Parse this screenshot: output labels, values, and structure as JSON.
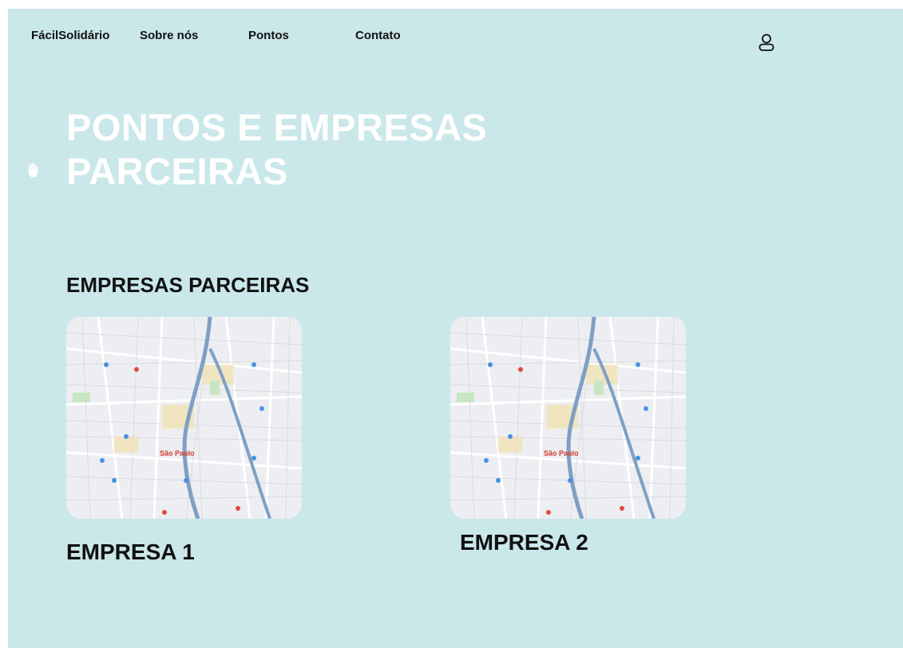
{
  "nav": {
    "brand": "FácilSolidário",
    "items": [
      {
        "label": "Sobre nós"
      },
      {
        "label": "Pontos"
      },
      {
        "label": "Contato"
      }
    ],
    "user_icon": "user-icon"
  },
  "hero": {
    "title": "PONTOS E EMPRESAS\nPARCEIRAS",
    "icon": "hand-icon"
  },
  "partners": {
    "section_title": "EMPRESAS PARCEIRAS",
    "cards": [
      {
        "title": "EMPRESA 1",
        "map_city_label": "São Paulo"
      },
      {
        "title": "EMPRESA 2",
        "map_city_label": "São Paulo"
      }
    ]
  },
  "colors": {
    "background": "#cae7ea",
    "hero_text": "#ffffff",
    "text": "#111111",
    "map_bg": "#eceef1",
    "map_river": "#7f9fc4",
    "map_label": "#d23b2b"
  }
}
